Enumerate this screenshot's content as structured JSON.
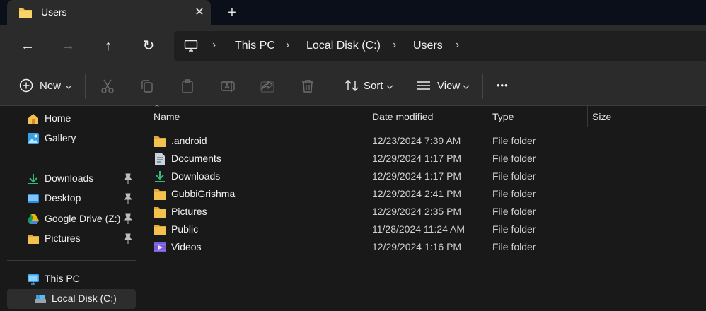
{
  "window": {
    "tab_title": "Users",
    "close_symbol": "✕",
    "new_tab_symbol": "+"
  },
  "nav": {
    "back": "←",
    "forward": "→",
    "up": "↑",
    "refresh": "↻"
  },
  "breadcrumb": {
    "items": [
      "This PC",
      "Local Disk (C:)",
      "Users"
    ],
    "separator": "›"
  },
  "toolbar": {
    "new_label": "New",
    "sort_label": "Sort",
    "view_label": "View",
    "more_label": "•••"
  },
  "sidebar": {
    "items": [
      {
        "label": "Home",
        "icon": "home-icon"
      },
      {
        "label": "Gallery",
        "icon": "gallery-icon"
      },
      {
        "label": "Downloads",
        "icon": "download-icon",
        "pinned": true
      },
      {
        "label": "Desktop",
        "icon": "desktop-icon",
        "pinned": true
      },
      {
        "label": "Google Drive (Z:)",
        "icon": "google-drive-icon",
        "pinned": true
      },
      {
        "label": "Pictures",
        "icon": "folder-icon",
        "pinned": true
      },
      {
        "label": "This PC",
        "icon": "pc-icon"
      },
      {
        "label": "Local Disk (C:)",
        "icon": "drive-icon",
        "selected": true
      }
    ]
  },
  "columns": {
    "name": "Name",
    "date": "Date modified",
    "type": "Type",
    "size": "Size"
  },
  "files": [
    {
      "name": ".android",
      "date": "12/23/2024 7:39 AM",
      "type": "File folder",
      "icon": "folder-icon"
    },
    {
      "name": "Documents",
      "date": "12/29/2024 1:17 PM",
      "type": "File folder",
      "icon": "documents-icon"
    },
    {
      "name": "Downloads",
      "date": "12/29/2024 1:17 PM",
      "type": "File folder",
      "icon": "download-icon"
    },
    {
      "name": "GubbiGrishma",
      "date": "12/29/2024 2:41 PM",
      "type": "File folder",
      "icon": "folder-icon"
    },
    {
      "name": "Pictures",
      "date": "12/29/2024 2:35 PM",
      "type": "File folder",
      "icon": "folder-icon"
    },
    {
      "name": "Public",
      "date": "11/28/2024 11:24 AM",
      "type": "File folder",
      "icon": "folder-icon"
    },
    {
      "name": "Videos",
      "date": "12/29/2024 1:16 PM",
      "type": "File folder",
      "icon": "videos-icon"
    }
  ],
  "colors": {
    "folder": "#f2c14e",
    "accent": "#3aa0e8",
    "download": "#37b87c"
  }
}
